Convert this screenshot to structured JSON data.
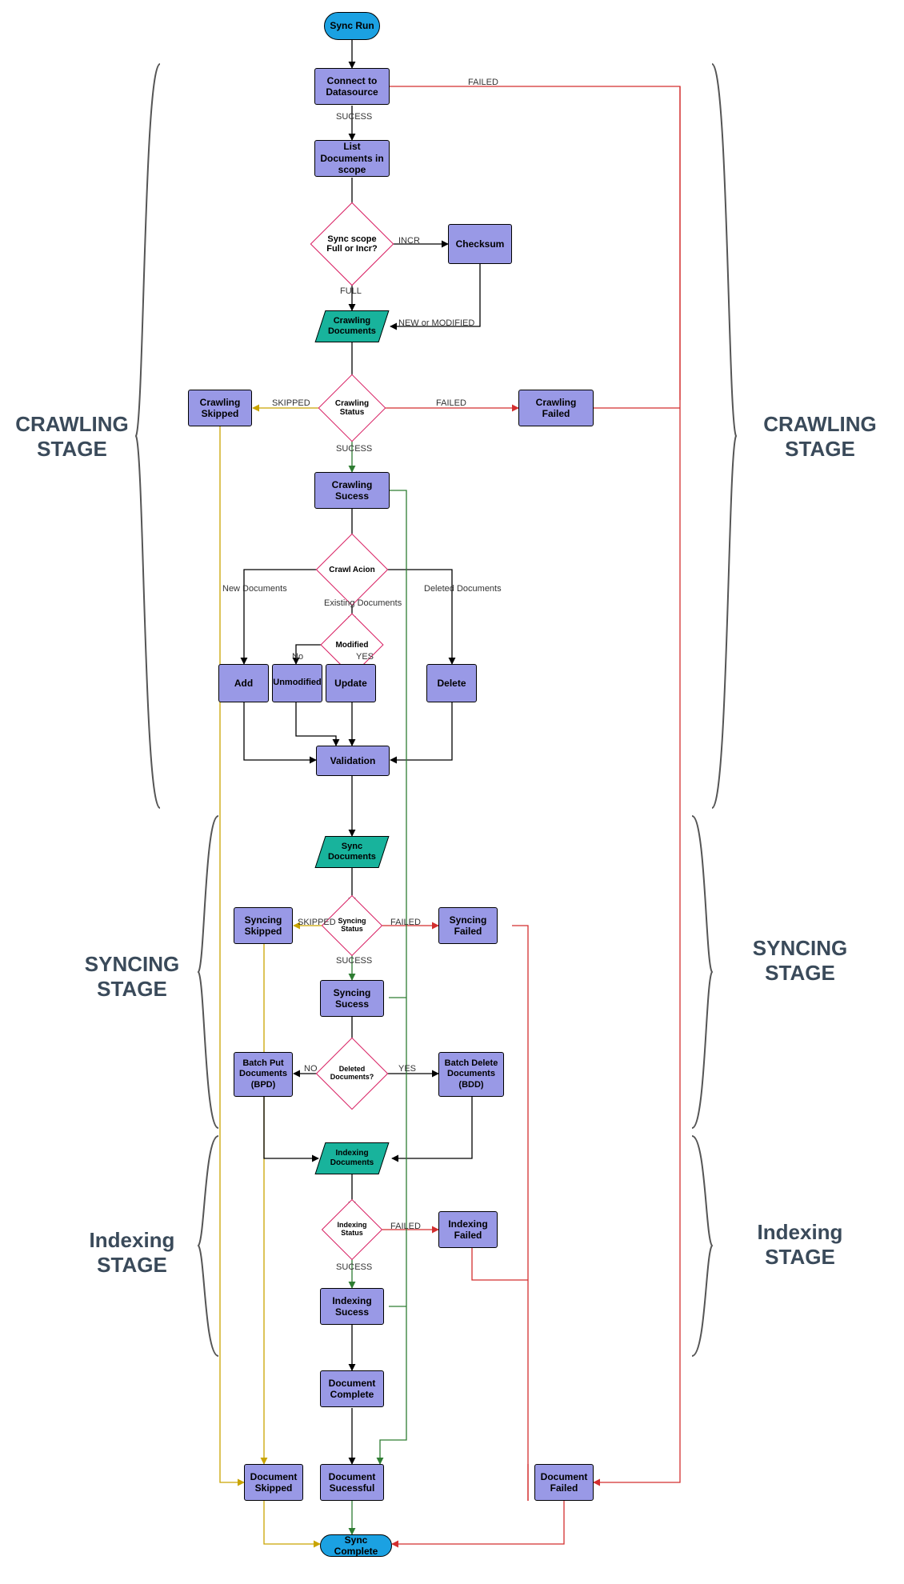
{
  "nodes": {
    "sync_run": "Sync Run",
    "connect": "Connect to Datasource",
    "list_docs": "List Documents in scope",
    "sync_scope": "Sync scope Full or Incr?",
    "checksum": "Checksum",
    "crawling_docs": "Crawling Documents",
    "crawling_status": "Crawling Status",
    "crawling_skipped": "Crawling Skipped",
    "crawling_failed": "Crawling Failed",
    "crawling_success": "Crawling Sucess",
    "crawl_action": "Crawl Acion",
    "modified": "Modified",
    "add": "Add",
    "unmodified": "Unmodified",
    "update": "Update",
    "delete": "Delete",
    "validation": "Validation",
    "sync_docs": "Sync Documents",
    "syncing_status": "Syncing Status",
    "syncing_skipped": "Syncing Skipped",
    "syncing_failed": "Syncing Failed",
    "syncing_success": "Syncing Sucess",
    "deleted_docs_q": "Deleted Documents?",
    "bpd": "Batch Put Documents (BPD)",
    "bdd": "Batch Delete Documents (BDD)",
    "indexing_docs": "Indexing Documents",
    "indexing_status": "Indexing Status",
    "indexing_failed": "Indexing Failed",
    "indexing_success": "Indexing Sucess",
    "doc_complete": "Document Complete",
    "doc_skipped": "Document Skipped",
    "doc_successful": "Document Sucessful",
    "doc_failed": "Document Failed",
    "sync_complete": "Sync Complete"
  },
  "edges": {
    "success": "SUCESS",
    "failed": "FAILED",
    "incr": "INCR",
    "full": "FULL",
    "new_modified": "NEW or MODIFIED",
    "skipped": "SKIPPED",
    "new_docs": "New Documents",
    "existing_docs": "Existing Documents",
    "deleted_docs": "Deleted Documents",
    "no": "No",
    "yes_upper": "YES",
    "no_upper": "NO"
  },
  "stages": {
    "crawling": "CRAWLING STAGE",
    "syncing": "SYNCING STAGE",
    "indexing": "Indexing STAGE"
  }
}
